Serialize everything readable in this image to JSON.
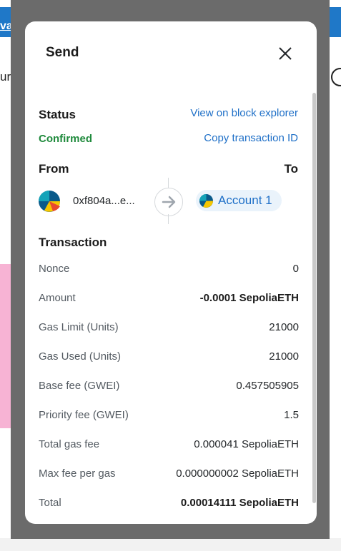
{
  "background": {
    "bar_text": "va",
    "left_text": "ur"
  },
  "modal": {
    "title": "Send",
    "close_icon": "close-icon"
  },
  "status": {
    "label": "Status",
    "value": "Confirmed",
    "view_explorer_link": "View on block explorer",
    "copy_tx_link": "Copy transaction ID"
  },
  "from_to": {
    "from_label": "From",
    "to_label": "To",
    "from_address": "0xf804a...e...",
    "to_account": "Account 1"
  },
  "transaction": {
    "heading": "Transaction",
    "rows": [
      {
        "label": "Nonce",
        "value": "0",
        "bold": false
      },
      {
        "label": "Amount",
        "value": "-0.0001 SepoliaETH",
        "bold": true
      },
      {
        "label": "Gas Limit (Units)",
        "value": "21000",
        "bold": false
      },
      {
        "label": "Gas Used (Units)",
        "value": "21000",
        "bold": false
      },
      {
        "label": "Base fee (GWEI)",
        "value": "0.457505905",
        "bold": false
      },
      {
        "label": "Priority fee (GWEI)",
        "value": "1.5",
        "bold": false
      },
      {
        "label": "Total gas fee",
        "value": "0.000041 SepoliaETH",
        "bold": false
      },
      {
        "label": "Max fee per gas",
        "value": "0.000000002 SepoliaETH",
        "bold": false
      },
      {
        "label": "Total",
        "value": "0.00014111 SepoliaETH",
        "bold": true
      }
    ]
  },
  "colors": {
    "confirmed": "#1f8a3c",
    "link": "#1e6fc7",
    "overlay": "#6b6b6b"
  }
}
